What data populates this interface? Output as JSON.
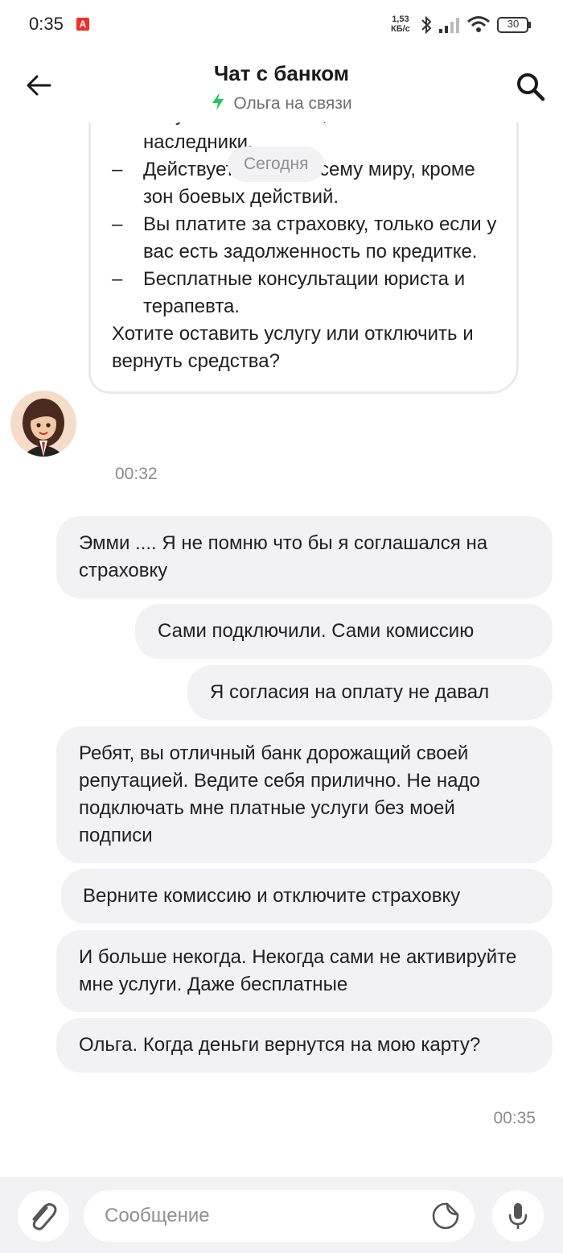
{
  "status_bar": {
    "time": "0:35",
    "app_badge": "A",
    "speed_value": "1,53",
    "speed_unit": "КБ/с",
    "battery": "30",
    "icons": [
      "bluetooth-icon",
      "signal-icon",
      "wifi-icon",
      "battery-icon"
    ]
  },
  "header": {
    "title": "Чат с банком",
    "subtitle": "Ольга на связи",
    "back_icon": "arrow-left-icon",
    "search_icon": "search-icon"
  },
  "chat": {
    "date_pill": "Сегодня",
    "bank_message": {
      "items": [
        "Выплаты по любому риску могут получить как клиент, так и его наследники.",
        "Действует 24/7 по всему миру, кроме зон боевых действий.",
        "Вы платите за страховку, только если у вас есть задолженность по кредитке.",
        "Бесплатные консультации юриста и терапевта."
      ],
      "closing": "Хотите оставить услугу или отключить и вернуть средства?",
      "time": "00:32"
    },
    "user_messages": [
      "Эмми .... Я не помню что бы я соглашался на страховку",
      "Сами подключили. Сами комиссию",
      "Я согласия на оплату не давал",
      "Ребят, вы отличный банк дорожащий своей репутацией. Ведите себя прилично. Не надо подключать мне платные услуги без моей подписи",
      "Верните комиссию и отключите страховку",
      "И больше некогда. Некогда сами не активируйте мне услуги. Даже бесплатные",
      "Ольга. Когда деньги вернутся на мою карту?"
    ],
    "user_time": "00:35"
  },
  "composer": {
    "placeholder": "Сообщение"
  },
  "colors": {
    "bubble_bg": "#f2f2f4",
    "online_bolt": "#22c55e",
    "badge_red": "#ef3124"
  }
}
